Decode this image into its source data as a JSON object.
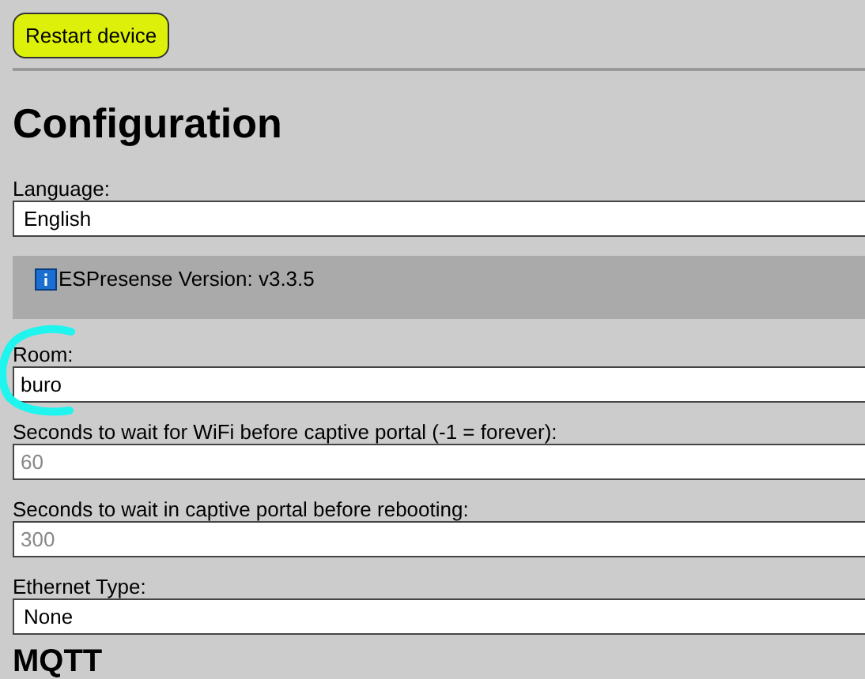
{
  "restart_button": {
    "label": "Restart device"
  },
  "heading": "Configuration",
  "fields": [
    {
      "kind": "select",
      "label": "Language:",
      "value": "English"
    },
    {
      "kind": "info",
      "text": "ESPresense Version: v3.3.5"
    },
    {
      "kind": "input",
      "label": "Room:",
      "value": "buro"
    },
    {
      "kind": "input",
      "label": "Seconds to wait for WiFi before captive portal (-1 = forever):",
      "placeholder": "60"
    },
    {
      "kind": "input",
      "label": "Seconds to wait in captive portal before rebooting:",
      "placeholder": "300"
    },
    {
      "kind": "select",
      "label": "Ethernet Type:",
      "value": "None"
    }
  ],
  "next_heading": "MQTT"
}
